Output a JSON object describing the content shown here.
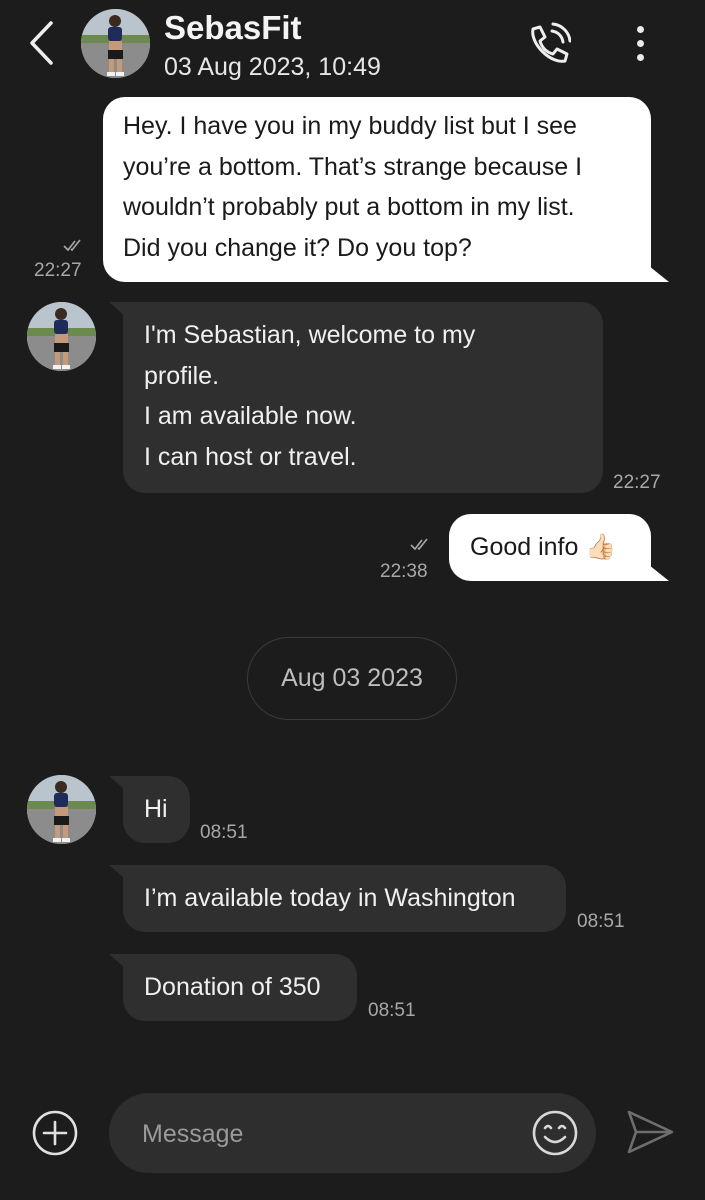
{
  "header": {
    "contact_name": "SebasFit",
    "contact_date": "03 Aug 2023, 10:49",
    "icons": {
      "back": "chevron-left-icon",
      "call": "phone-call-icon",
      "more": "more-vertical-icon"
    }
  },
  "messages": [
    {
      "direction": "outgoing",
      "lines": [
        "Hey. I have you in my buddy list but I see",
        "you’re a bottom. That’s strange because I",
        "wouldn’t probably put a bottom in my list.",
        "Did you change it? Do you top?"
      ],
      "time": "22:27",
      "status": "read"
    },
    {
      "direction": "incoming",
      "lines": [
        "I'm Sebastian, welcome to my",
        "profile.",
        "I am available now.",
        "I can host or travel."
      ],
      "time": "22:27"
    },
    {
      "direction": "outgoing",
      "lines": [
        "Good info 👍🏻"
      ],
      "text": "Good info",
      "emoji": "👍🏻",
      "time": "22:38",
      "status": "read"
    },
    {
      "direction": "incoming",
      "lines": [
        "Hi"
      ],
      "time": "08:51"
    },
    {
      "direction": "incoming",
      "lines": [
        "I’m available today in Washington"
      ],
      "time": "08:51"
    },
    {
      "direction": "incoming",
      "lines": [
        "Donation of 350"
      ],
      "time": "08:51"
    }
  ],
  "date_separator": "Aug 03 2023",
  "composer": {
    "placeholder": "Message",
    "value": "",
    "icons": {
      "add": "plus-circle-icon",
      "emoji": "smiley-icon",
      "send": "send-icon"
    }
  },
  "colors": {
    "background": "#1c1c1c",
    "outgoing_bubble": "#ffffff",
    "incoming_bubble": "#2f2f2f",
    "timestamp": "#a8a8a8"
  }
}
